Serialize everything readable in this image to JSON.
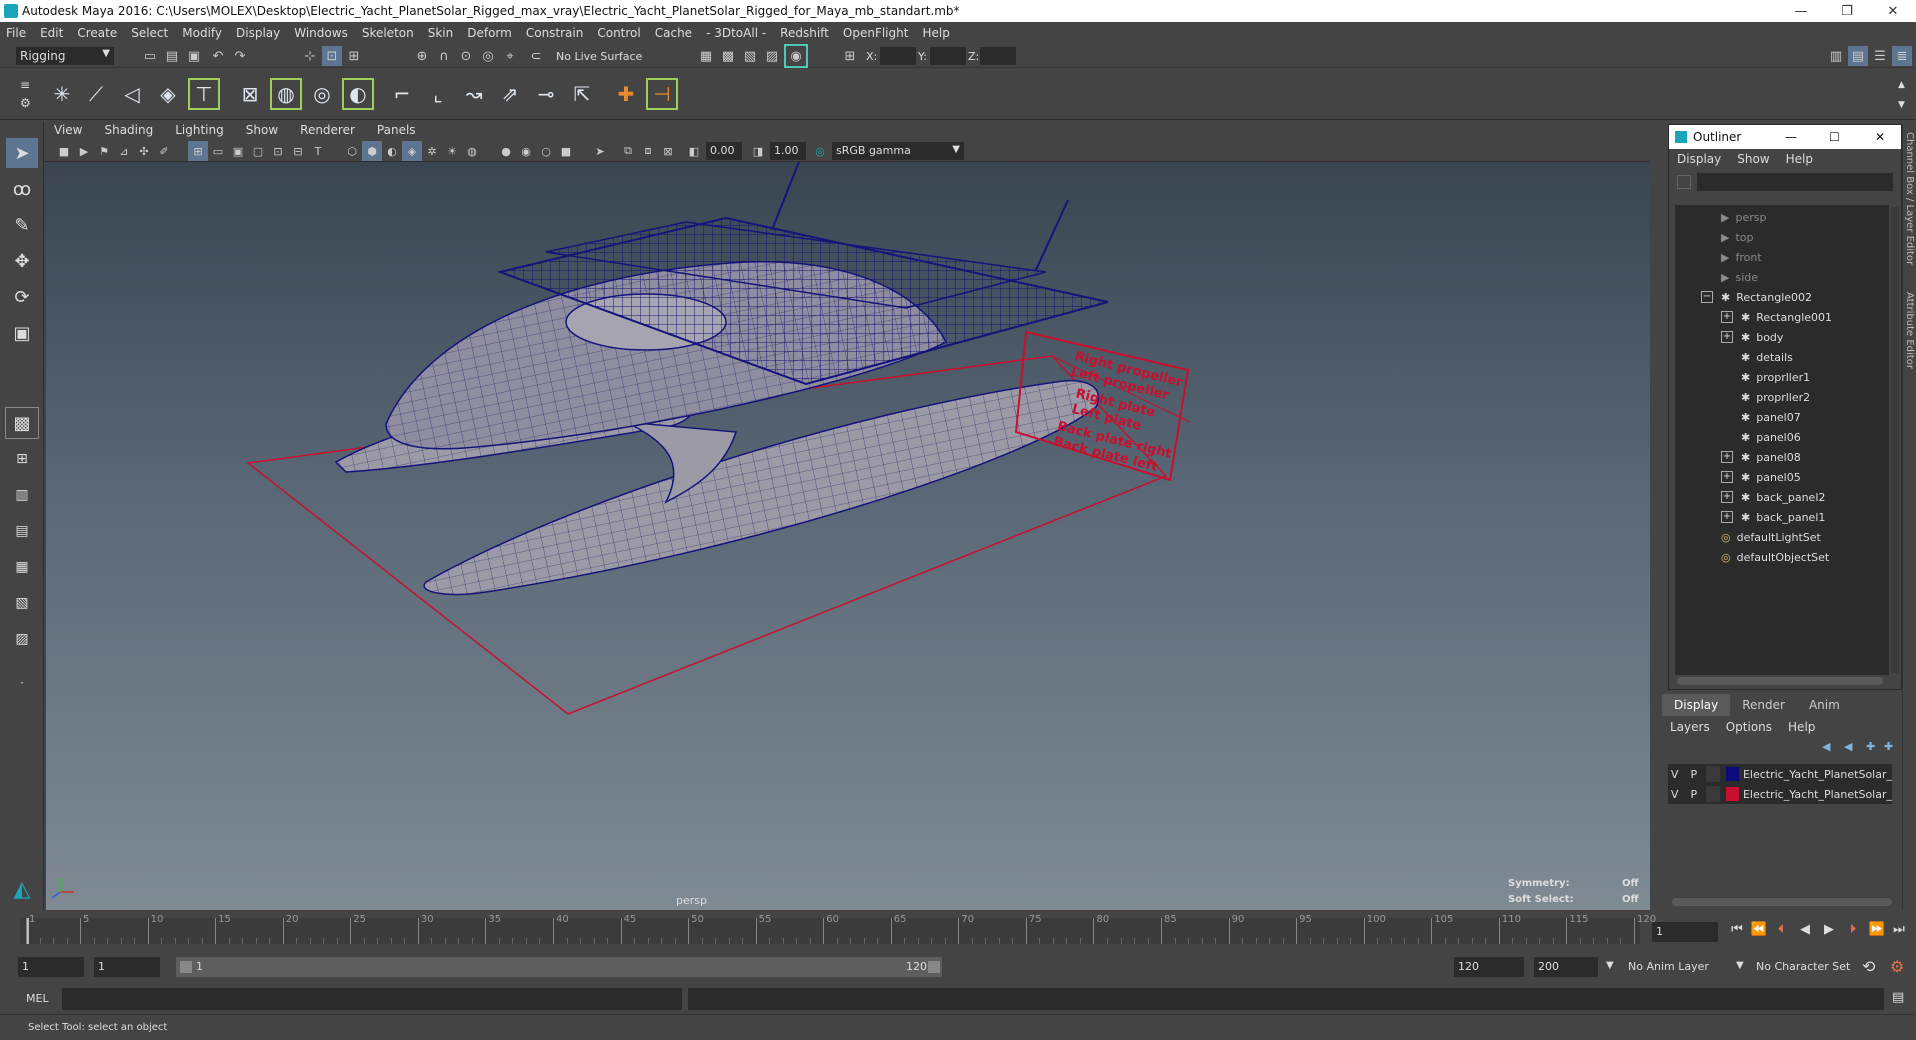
{
  "app": {
    "title": "Autodesk Maya 2016: C:\\Users\\MOLEX\\Desktop\\Electric_Yacht_PlanetSolar_Rigged_max_vray\\Electric_Yacht_PlanetSolar_Rigged_for_Maya_mb_standart.mb*",
    "minimize": "—",
    "restore": "❐",
    "close": "✕"
  },
  "menu": [
    "File",
    "Edit",
    "Create",
    "Select",
    "Modify",
    "Display",
    "Windows",
    "Skeleton",
    "Skin",
    "Deform",
    "Constrain",
    "Control",
    "Cache",
    "- 3DtoAll -",
    "Redshift",
    "OpenFlight",
    "Help"
  ],
  "statusline": {
    "mode": "Rigging",
    "live_surface": "No Live Surface",
    "x_label": "X:",
    "y_label": "Y:",
    "z_label": "Z:"
  },
  "viewport": {
    "menu": [
      "View",
      "Shading",
      "Lighting",
      "Show",
      "Renderer",
      "Panels"
    ],
    "exposure": "0.00",
    "gamma": "1.00",
    "colorspace": "sRGB gamma",
    "camera_label": "persp",
    "symmetry_label": "Symmetry:",
    "symmetry_value": "Off",
    "soft_select_label": "Soft Select:",
    "soft_select_value": "Off",
    "wire_color": "#14147a",
    "control_color": "#c8102e"
  },
  "rig_labels": [
    "Right propeller",
    "Left propeller",
    "Right plate",
    "Left plate",
    "Back plate right",
    "Back plate left"
  ],
  "outliner": {
    "title": "Outliner",
    "menu": [
      "Display",
      "Show",
      "Help"
    ],
    "items": [
      {
        "label": "persp",
        "indent": 0,
        "dim": true,
        "icon": "camera-icon",
        "exp": ""
      },
      {
        "label": "top",
        "indent": 0,
        "dim": true,
        "icon": "camera-icon",
        "exp": ""
      },
      {
        "label": "front",
        "indent": 0,
        "dim": true,
        "icon": "camera-icon",
        "exp": ""
      },
      {
        "label": "side",
        "indent": 0,
        "dim": true,
        "icon": "camera-icon",
        "exp": ""
      },
      {
        "label": "Rectangle002",
        "indent": 0,
        "dim": false,
        "icon": "curve-icon",
        "exp": "−"
      },
      {
        "label": "Rectangle001",
        "indent": 1,
        "dim": false,
        "icon": "curve-icon",
        "exp": "+"
      },
      {
        "label": "body",
        "indent": 1,
        "dim": false,
        "icon": "curve-icon",
        "exp": "+"
      },
      {
        "label": "details",
        "indent": 1,
        "dim": false,
        "icon": "curve-icon",
        "exp": ""
      },
      {
        "label": "proprller1",
        "indent": 1,
        "dim": false,
        "icon": "curve-icon",
        "exp": ""
      },
      {
        "label": "proprller2",
        "indent": 1,
        "dim": false,
        "icon": "curve-icon",
        "exp": ""
      },
      {
        "label": "panel07",
        "indent": 1,
        "dim": false,
        "icon": "curve-icon",
        "exp": ""
      },
      {
        "label": "panel06",
        "indent": 1,
        "dim": false,
        "icon": "curve-icon",
        "exp": ""
      },
      {
        "label": "panel08",
        "indent": 1,
        "dim": false,
        "icon": "curve-icon",
        "exp": "+"
      },
      {
        "label": "panel05",
        "indent": 1,
        "dim": false,
        "icon": "curve-icon",
        "exp": "+"
      },
      {
        "label": "back_panel2",
        "indent": 1,
        "dim": false,
        "icon": "curve-icon",
        "exp": "+"
      },
      {
        "label": "back_panel1",
        "indent": 1,
        "dim": false,
        "icon": "curve-icon",
        "exp": "+"
      },
      {
        "label": "defaultLightSet",
        "indent": 0,
        "dim": false,
        "icon": "set-icon",
        "exp": ""
      },
      {
        "label": "defaultObjectSet",
        "indent": 0,
        "dim": false,
        "icon": "set-icon",
        "exp": ""
      }
    ]
  },
  "layer_editor": {
    "tabs": [
      "Display",
      "Render",
      "Anim"
    ],
    "menu": [
      "Layers",
      "Options",
      "Help"
    ],
    "layers": [
      {
        "v": "V",
        "p": "P",
        "name": "Electric_Yacht_PlanetSolar_",
        "color": "#0b0b7a"
      },
      {
        "v": "V",
        "p": "P",
        "name": "Electric_Yacht_PlanetSolar_",
        "color": "#c8102e"
      }
    ]
  },
  "side_tabs": [
    "Channel Box / Layer Editor",
    "Attribute Editor"
  ],
  "timeline": {
    "ticks": [
      "1",
      "5",
      "10",
      "15",
      "20",
      "25",
      "30",
      "35",
      "40",
      "45",
      "50",
      "55",
      "60",
      "65",
      "70",
      "75",
      "80",
      "85",
      "90",
      "95",
      "100",
      "105",
      "110",
      "115",
      "120"
    ],
    "current_frame": "1"
  },
  "range": {
    "start": "1",
    "playback_start": "1",
    "slider_start": "1",
    "slider_end": "120",
    "playback_end": "120",
    "end": "200",
    "anim_layer": "No Anim Layer",
    "character_set": "No Character Set"
  },
  "command": {
    "label": "MEL"
  },
  "help": {
    "text": "Select Tool: select an object"
  }
}
